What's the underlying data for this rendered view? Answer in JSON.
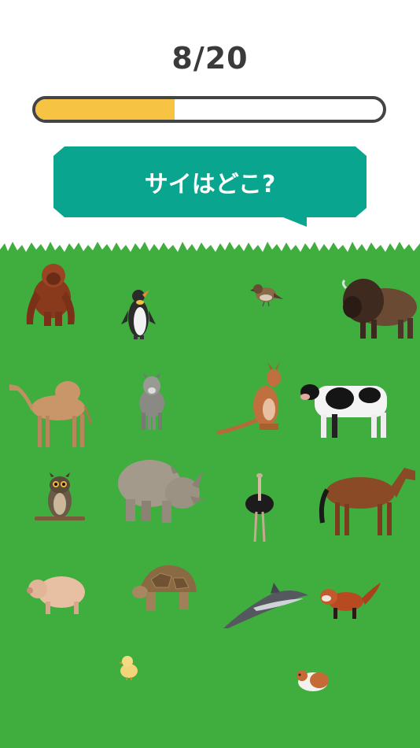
{
  "progress": {
    "text": "8/20",
    "current": 8,
    "total": 20,
    "fraction": 0.4,
    "fill_color": "#f6c343"
  },
  "question": {
    "text": "サイはどこ?",
    "bubble_color": "#0aa58f"
  },
  "field": {
    "color": "#3fae3f"
  },
  "animals": [
    "orangutan",
    "penguin",
    "sparrow",
    "bison",
    "camel",
    "wolf",
    "kangaroo",
    "cow",
    "owl",
    "rhinoceros",
    "ostrich",
    "horse",
    "pig",
    "tortoise",
    "dolphin",
    "red-panda",
    "chick",
    "guinea-pig"
  ]
}
